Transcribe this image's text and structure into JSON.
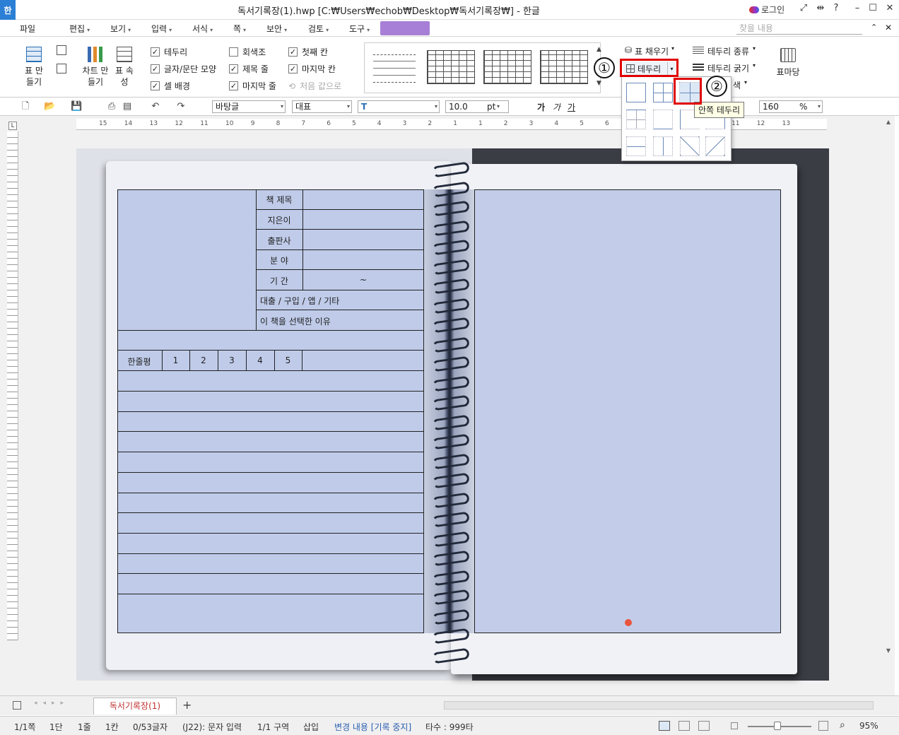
{
  "titlebar": {
    "app_icon": "한",
    "title": "독서기록장(1).hwp [C:₩Users₩echob₩Desktop₩독서기록장₩] - 한글",
    "login": "로그인"
  },
  "menubar": {
    "items": [
      "파일",
      "편집",
      "보기",
      "입력",
      "서식",
      "쪽",
      "보안",
      "검토",
      "도구"
    ],
    "search_placeholder": "찾을 내용"
  },
  "ribbon": {
    "table_create": "표 만들기",
    "chart_create": "차트 만들기",
    "table_props": "표 속성",
    "checks": [
      {
        "label": "테두리",
        "checked": true
      },
      {
        "label": "글자/문단 모양",
        "checked": true
      },
      {
        "label": "셀 배경",
        "checked": true
      },
      {
        "label": "회색조",
        "checked": false
      },
      {
        "label": "제목 줄",
        "checked": true
      },
      {
        "label": "마지막 줄",
        "checked": true
      },
      {
        "label": "첫째 칸",
        "checked": true
      },
      {
        "label": "마지막 칸",
        "checked": true
      },
      {
        "label": "처음 값으로",
        "checked": false
      }
    ],
    "fill": "표 채우기",
    "border": "테두리",
    "border_type": "테두리 종류",
    "border_width": "테두리 굵기",
    "color": "색",
    "table_mark": "표마당"
  },
  "toolbar2": {
    "style": "바탕글",
    "font_group": "대표",
    "font": "T",
    "size": "10.0",
    "unit": "pt",
    "zoom": "160",
    "zoom_unit": "%",
    "bold": "가",
    "italic": "가",
    "underline": "가"
  },
  "popup": {
    "tooltip": "안쪽 테두리"
  },
  "annotations": {
    "one": "①",
    "two": "②"
  },
  "ruler": {
    "ticks": [
      "15",
      "14",
      "13",
      "12",
      "11",
      "10",
      "9",
      "8",
      "7",
      "6",
      "5",
      "4",
      "3",
      "2",
      "1",
      "1",
      "2",
      "3",
      "4",
      "5",
      "6",
      "7",
      "8",
      "9",
      "10",
      "11",
      "12",
      "13"
    ]
  },
  "form": {
    "labels": [
      "책 제목",
      "지은이",
      "출판사",
      "분 야",
      "기 간"
    ],
    "period_sep": "~",
    "row_loan": "대출 / 구입 / 앱 / 기타",
    "row_reason": "이 책을 선택한 이유",
    "rating_label": "한줄평",
    "ratings": [
      "1",
      "2",
      "3",
      "4",
      "5"
    ]
  },
  "tabbar": {
    "doc_tab": "독서기록장(1)",
    "add": "+"
  },
  "statusbar": {
    "page": "1/1쪽",
    "col": "1단",
    "line": "1줄",
    "cell": "1칸",
    "chars": "0/53글자",
    "mode": "(J22): 문자 입력",
    "section": "1/1 구역",
    "insert": "삽입",
    "track": "변경 내용 [기록 중지]",
    "typing": "타수 : 999타",
    "zoom": "95%"
  },
  "colors": {
    "accent": "#2b7fd4",
    "form_bg": "#bfcbe9",
    "highlight": "#e00000"
  }
}
